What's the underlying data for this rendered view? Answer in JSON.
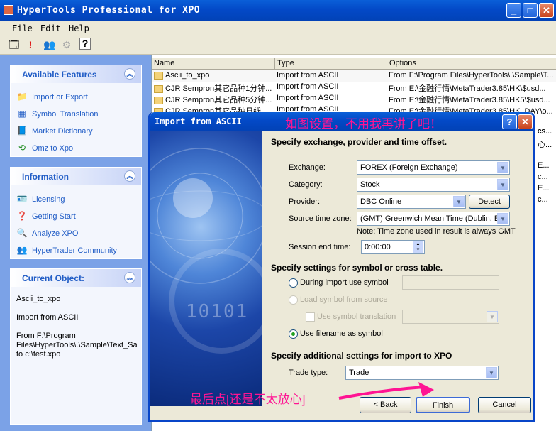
{
  "window": {
    "title": "HyperTools Professional for XPO",
    "min": "_",
    "max": "□",
    "close": "✕"
  },
  "menu": [
    "File",
    "Edit",
    "Help"
  ],
  "toolbar": {
    "icons": [
      "properties-icon",
      "exclaim-icon",
      "users-icon",
      "disabled-icon",
      "help-icon"
    ],
    "exclaim": "!",
    "help": "?"
  },
  "sidebar": {
    "features": {
      "title": "Available Features",
      "items": [
        "Import or Export",
        "Symbol Translation",
        "Market Dictionary",
        "Omz to Xpo"
      ]
    },
    "information": {
      "title": "Information",
      "items": [
        "Licensing",
        "Getting Start",
        "Analyze XPO",
        "HyperTrader Community"
      ]
    },
    "current": {
      "title": "Current Object:",
      "name": "Ascii_to_xpo",
      "type": "Import from ASCII",
      "from": "From F:\\Program Files\\HyperTools\\.\\Sample\\Text_Sa to c:\\test.xpo"
    }
  },
  "list": {
    "columns": [
      "Name",
      "Type",
      "Options"
    ],
    "rows": [
      {
        "name": "Ascii_to_xpo",
        "type": "Import from ASCII",
        "options": "From F:\\Program Files\\HyperTools\\.\\Sample\\T..."
      },
      {
        "name": "CJR Sempron其它品种1分钟...",
        "type": "Import from ASCII",
        "options": "From E:\\金融行情\\MetaTrader3.85\\HK\\$usd..."
      },
      {
        "name": "CJR Sempron其它品种5分钟...",
        "type": "Import from ASCII",
        "options": "From E:\\金融行情\\MetaTrader3.85\\HK5\\$usd..."
      },
      {
        "name": "CJR Sempron其它品种日线",
        "type": "Import from ASCII",
        "options": "From E:\\金融行情\\MetaTrader3.85\\HK_DAY\\o..."
      }
    ],
    "right_fragments": [
      "cs...",
      "心...",
      "E...",
      "c...",
      "E...",
      "c..."
    ]
  },
  "dialog": {
    "title": "Import from ASCII",
    "help": "?",
    "close": "✕",
    "annotation_top": "如图设置，不用我再讲了吧！",
    "art_digits": "10101",
    "section1": "Specify exchange, provider and time offset.",
    "exchange_label": "Exchange:",
    "exchange_value": "FOREX (Foreign Exchange)",
    "category_label": "Category:",
    "category_value": "Stock",
    "provider_label": "Provider:",
    "provider_value": "DBC Online",
    "detect": "Detect",
    "tz_label": "Source time zone:",
    "tz_value": "(GMT) Greenwich Mean Time (Dublin, Edi",
    "tz_note": "Note: Time zone used in result is always GMT",
    "session_label": "Session end time:",
    "session_value": "0:00:00",
    "section2": "Specify settings for symbol or cross table.",
    "radio_during": "During import use symbol",
    "radio_load": "Load symbol from source",
    "chk_translation": "Use symbol translation",
    "radio_filename": "Use filename as symbol",
    "section3": "Specify additional settings for import to XPO",
    "trade_label": "Trade type:",
    "trade_value": "Trade",
    "back": "< Back",
    "finish": "Finish",
    "cancel": "Cancel"
  },
  "annotation_bottom": "最后点[还是不太放心]",
  "colors": {
    "accent": "#0a5fd8",
    "annotation": "#ff1493",
    "link": "#215dc6"
  }
}
